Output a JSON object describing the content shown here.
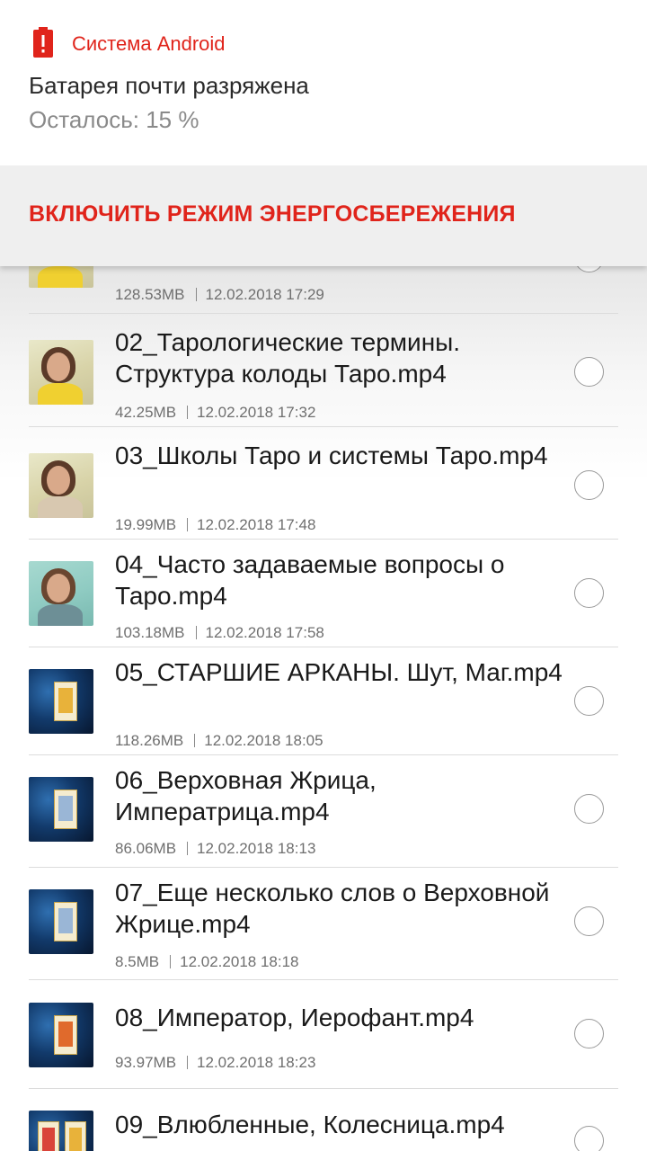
{
  "notification": {
    "app_name": "Система Android",
    "title": "Батарея почти разряжена",
    "text": "Осталось: 15 %",
    "action_label": "ВКЛЮЧИТЬ РЕЖИМ ЭНЕРГОСБЕРЕЖЕНИЯ",
    "accent_color": "#e0241b",
    "icon": "battery-low-icon"
  },
  "files": [
    {
      "title": "",
      "size": "128.53MB",
      "date": "12.02.2018 17:29",
      "selected": false
    },
    {
      "title": "02_Тарологические термины. Структура колоды Таро.mp4",
      "size": "42.25MB",
      "date": "12.02.2018 17:32",
      "selected": false
    },
    {
      "title": "03_Школы Таро и системы Таро.mp4",
      "size": "19.99MB",
      "date": "12.02.2018 17:48",
      "selected": false
    },
    {
      "title": "04_Часто задаваемые вопросы о Таро.mp4",
      "size": "103.18MB",
      "date": "12.02.2018 17:58",
      "selected": false
    },
    {
      "title": "05_СТАРШИЕ АРКАНЫ. Шут, Маг.mp4",
      "size": "118.26MB",
      "date": "12.02.2018 18:05",
      "selected": false
    },
    {
      "title": "06_Верховная Жрица, Императрица.mp4",
      "size": "86.06MB",
      "date": "12.02.2018 18:13",
      "selected": false
    },
    {
      "title": "07_Еще несколько слов о Верховной Жрице.mp4",
      "size": "8.5MB",
      "date": "12.02.2018 18:18",
      "selected": false
    },
    {
      "title": "08_Император, Иерофант.mp4",
      "size": "93.97MB",
      "date": "12.02.2018 18:23",
      "selected": false
    },
    {
      "title": "09_Влюбленные, Колесница.mp4",
      "size": "",
      "date": "",
      "selected": false
    }
  ]
}
